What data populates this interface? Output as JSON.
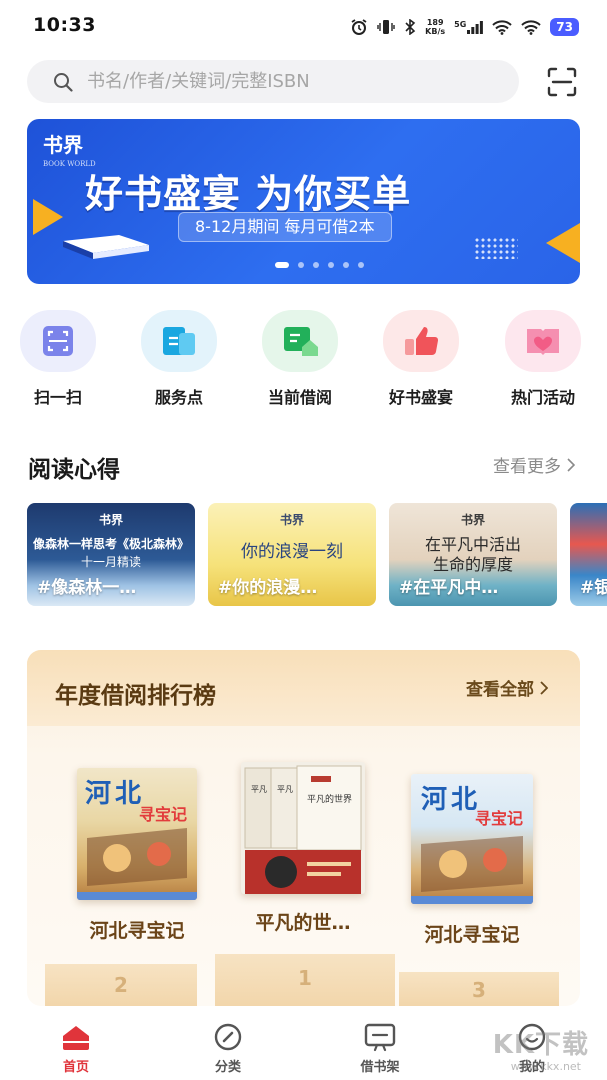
{
  "status_bar": {
    "time": "10:33",
    "net_speed_value": "189",
    "net_speed_unit": "KB/s",
    "network": "5G",
    "battery": "73"
  },
  "search": {
    "placeholder": "书名/作者/关键词/完整ISBN",
    "scan_icon": "scan-frame-icon"
  },
  "banner": {
    "logo": "书界",
    "logo_small": "BOOK WORLD",
    "title": "好书盛宴 为你买单",
    "subtitle": "8-12月期间 每月可借2本",
    "pages": 6,
    "active_page": 1
  },
  "quick_nav": [
    {
      "label": "扫一扫",
      "icon": "scan-icon",
      "color": "#7b83ea"
    },
    {
      "label": "服务点",
      "icon": "service-point-icon",
      "color": "#1aa7e0"
    },
    {
      "label": "当前借阅",
      "icon": "current-borrow-icon",
      "color": "#22b05a"
    },
    {
      "label": "好书盛宴",
      "icon": "thumbs-up-icon",
      "color": "#f0545a"
    },
    {
      "label": "热门活动",
      "icon": "heart-book-icon",
      "color": "#f25c86"
    }
  ],
  "reading_notes": {
    "title": "阅读心得",
    "more": "查看更多",
    "cards": [
      {
        "logo": "书界",
        "line1": "像森林一样思考《极北森林》",
        "line2": "十一月精读",
        "tag": "#像森林一…"
      },
      {
        "logo": "书界",
        "line1": "你的浪漫一刻",
        "line2": "",
        "tag": "#你的浪漫…"
      },
      {
        "logo": "书界",
        "line1": "在平凡中活出",
        "line2": "生命的厚度",
        "tag": "#在平凡中…"
      },
      {
        "logo": "",
        "line1": "",
        "line2": "",
        "tag": "#银"
      }
    ]
  },
  "ranking": {
    "title": "年度借阅排行榜",
    "more": "查看全部",
    "books": [
      {
        "rank": "2",
        "title": "河北寻宝记",
        "cover_text": "河北寻宝记"
      },
      {
        "rank": "1",
        "title": "平凡的世…",
        "cover_text": "平凡的世界"
      },
      {
        "rank": "3",
        "title": "河北寻宝记",
        "cover_text": "河北寻宝记"
      }
    ]
  },
  "bottom_nav": [
    {
      "label": "首页",
      "icon": "home-icon",
      "active": true
    },
    {
      "label": "分类",
      "icon": "compass-icon",
      "active": false
    },
    {
      "label": "借书架",
      "icon": "bookshelf-icon",
      "active": false
    },
    {
      "label": "我的",
      "icon": "profile-icon",
      "active": false
    }
  ],
  "watermark": "KK下载",
  "watermark_url": "www.kkx.net",
  "colors": {
    "accent": "#e0343b",
    "banner_blue": "#2e6ef0",
    "rank_brown": "#5a3a12"
  }
}
